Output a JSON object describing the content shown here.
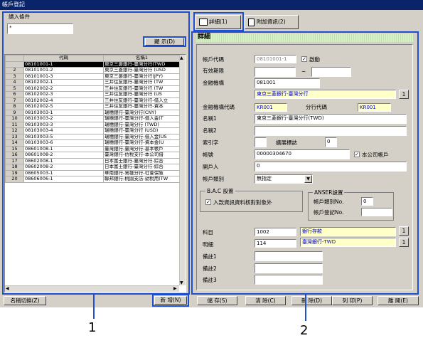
{
  "title": "帳戶登記",
  "left": {
    "group_label": "讀入條件",
    "condition_value": "*",
    "display_button": "顯 示(D)",
    "grid_headers": [
      "代碼",
      "名稱1"
    ],
    "rows": [
      {
        "n": "",
        "code": "08101001-1",
        "name": "東京三菱銀行-臺灣分行(TWD"
      },
      {
        "n": "2",
        "code": "08101001-2",
        "name": "東京三菱銀行-臺灣分行 (USD"
      },
      {
        "n": "3",
        "code": "08101001-3",
        "name": "東京三菱銀行-臺灣分行(JPY)"
      },
      {
        "n": "4",
        "code": "08102002-1",
        "name": "三井住友銀行-臺灣分行 (TW"
      },
      {
        "n": "5",
        "code": "08102002-2",
        "name": "三井住友銀行-臺灣分行 (TW"
      },
      {
        "n": "6",
        "code": "08102002-3",
        "name": "三井住友銀行-臺灣分行 (US"
      },
      {
        "n": "7",
        "code": "08102002-4",
        "name": "三井住友銀行-臺灣分行-借入立"
      },
      {
        "n": "8",
        "code": "08102002-5",
        "name": "三井住友銀行-臺灣分行-資本"
      },
      {
        "n": "9",
        "code": "08103003-1",
        "name": "瑞穗銀行-臺灣分行(CNY)"
      },
      {
        "n": "10",
        "code": "08103003-2",
        "name": "瑞穗銀行-臺灣分行-借入金(T"
      },
      {
        "n": "11",
        "code": "08103003-3",
        "name": "瑞穗銀行-臺灣分行 (TWD)"
      },
      {
        "n": "12",
        "code": "08103003-4",
        "name": "瑞穗銀行-臺灣分行 (USD)"
      },
      {
        "n": "13",
        "code": "08103003-5",
        "name": "瑞穗銀行-臺灣分行-借入金(US"
      },
      {
        "n": "14",
        "code": "08103003-6",
        "name": "瑞穗銀行-臺灣分行-資本金(U"
      },
      {
        "n": "15",
        "code": "08601008-1",
        "name": "臺灣銀行-臺灣分行-基本帳戶"
      },
      {
        "n": "16",
        "code": "08601008-2",
        "name": "臺灣銀行-仿稅支行-本公司借"
      },
      {
        "n": "17",
        "code": "08602008-1",
        "name": "日本富士銀行-臺灣分行-綜合"
      },
      {
        "n": "18",
        "code": "08602008-2",
        "name": "日本富士銀行-臺灣分行-綜合"
      },
      {
        "n": "19",
        "code": "08605003-1",
        "name": "華南銀行-寫雄分行-社會保險"
      },
      {
        "n": "20",
        "code": "08606006-1",
        "name": "聯邦銀行-桃園支店-幼稅用(TW"
      }
    ]
  },
  "tabs": [
    {
      "label": "詳細(1)"
    },
    {
      "label": "附加資訊(2)"
    }
  ],
  "detail": {
    "header": "詳細",
    "account_code_label": "帳戶代碼",
    "account_code": "08101001-1",
    "active_label": "啟動",
    "valid_period_label": "有效期限",
    "tilde": "~",
    "fi_label": "金融機構",
    "fi_code": "081001",
    "fi_name": "東京三菱銀行-臺灣分行",
    "fi_code2_label": "金融機構代碼",
    "fi_code2": "KR001",
    "branch_label": "分行代碼",
    "branch_code": "KR001",
    "name1_label": "名稱1",
    "name1": "東京三菱銀行-臺灣分行(TWD)",
    "name2_label": "名稱2",
    "index_label": "索引字",
    "stamp_label": "擴展標誌",
    "stamp_value": "0",
    "acct_no_label": "帳號",
    "acct_no": "00000304670",
    "own_label": "本公司帳戶",
    "opener_label": "開戶人",
    "opener": "0",
    "acct_type_label": "帳戶類別",
    "acct_type": "無指定",
    "bac_title": "B.A.C 設置",
    "bac_check": "入款資訊資料核對對象外",
    "anser_title": "ANSER設置",
    "anser_type_label": "帳戶類別No.",
    "anser_type": "0",
    "anser_reg_label": "帳戶登記No.",
    "subject_label": "科目",
    "subject_code": "1002",
    "subject_name": "銀行存款",
    "detail_label": "明細",
    "detail_code": "114",
    "detail_name": "臺灣銀行-TWD",
    "memo1_label": "備註1",
    "memo2_label": "備註2",
    "memo3_label": "備註3",
    "lookup": "1"
  },
  "buttons": {
    "name_switch": "名稱切換(Z)",
    "new": "新 增(N)",
    "save": "儲 存(S)",
    "clear": "清 除(C)",
    "delete": "刪 除(D)",
    "print": "列 印(P)",
    "exit": "離 開(E)"
  },
  "callouts": {
    "one": "1",
    "two": "2"
  }
}
